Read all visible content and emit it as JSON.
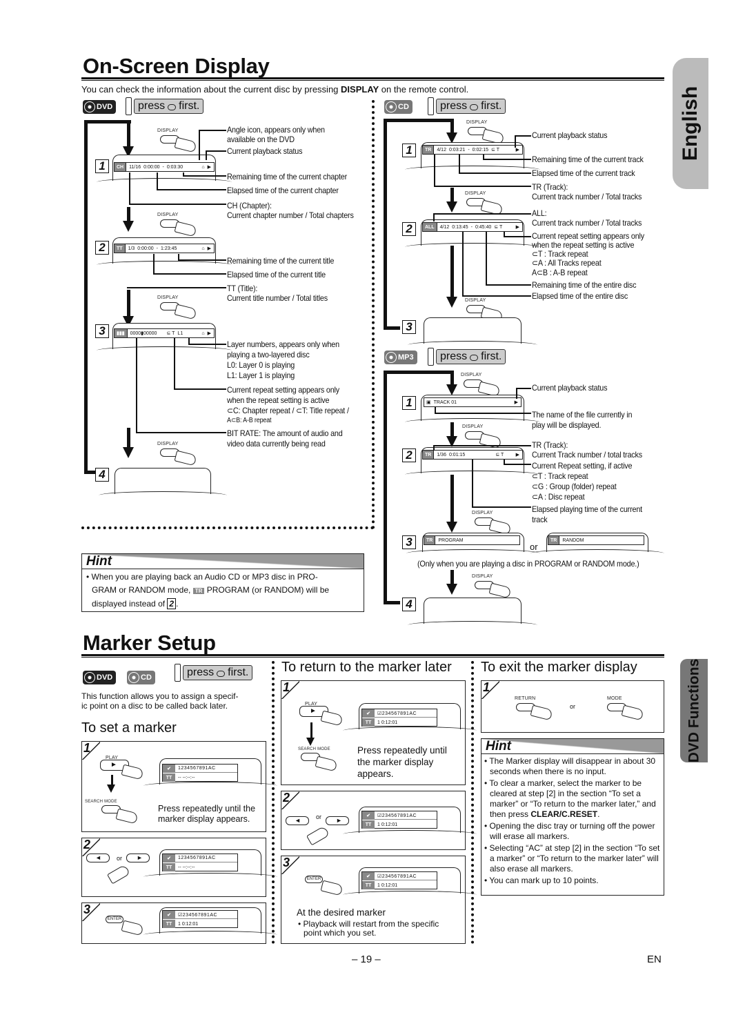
{
  "osd": {
    "title": "On-Screen Display",
    "intro_pre": "You can check the information about the current disc by pressing ",
    "intro_bold": "DISPLAY",
    "intro_post": " on the remote control.",
    "press_label": "press",
    "press_key": "DVD",
    "press_first": "first.",
    "display_btn": "DISPLAY",
    "dvd": {
      "badge": "DVD",
      "steps": [
        "1",
        "2",
        "3",
        "4"
      ],
      "step1": {
        "tag": "CH",
        "count": "11/16",
        "elapsed": "0:00:00",
        "remaining": "0:03:30",
        "status": "▶"
      },
      "step2": {
        "tag": "TT",
        "count": "1/3",
        "elapsed": "0:00:00",
        "remaining": "1:23:45",
        "status": "▶"
      },
      "step3": {
        "tag": "▮▮▮",
        "bitrate": "0000▮00000",
        "repeat": "⊆ T",
        "layer": "L1",
        "status": "▶"
      },
      "notes": [
        "Angle icon, appears only when",
        "available on the DVD",
        "Current playback status",
        "Remaining time of the current chapter",
        "Elapsed time of the current chapter",
        "CH (Chapter):",
        "Current chapter number / Total chapters",
        "Remaining time of the current title",
        "Elapsed time of the current title",
        "TT (Title):",
        "Current title number / Total titles",
        "Layer numbers, appears only when",
        "playing a two-layered disc",
        "L0: Layer 0 is playing",
        "L1: Layer 1 is playing",
        "Current repeat setting appears only",
        "when the repeat setting is active",
        "⊂C: Chapter repeat / ⊂T: Title repeat /",
        "A⊂B: A-B repeat",
        "BIT RATE: The amount of audio and",
        "video data currently being read"
      ]
    },
    "cd": {
      "badge": "CD",
      "steps": [
        "1",
        "2",
        "3"
      ],
      "step1": {
        "tag": "TR",
        "count": "4/12",
        "elapsed": "0:03:21",
        "remaining": "0:02:15",
        "repeat": "⊆ T",
        "status": "▶"
      },
      "step2": {
        "tag": "ALL",
        "count": "4/12",
        "elapsed": "0:13:45",
        "remaining": "0:45:40",
        "repeat": "⊆ T",
        "status": "▶"
      },
      "notes": [
        "Current playback status",
        "Remaining time of the current track",
        "Elapsed time of the current track",
        "TR (Track):",
        "Current track number / Total tracks",
        "ALL:",
        "Current track number / Total tracks",
        "Current repeat setting appears only",
        "when the repeat setting is active",
        "⊂T   : Track repeat",
        "⊂A   : All Tracks repeat",
        "A⊂B : A-B repeat",
        "Remaining time of the entire disc",
        "Elapsed time of the entire disc"
      ]
    },
    "mp3": {
      "badge": "MP3",
      "steps": [
        "1",
        "2",
        "3",
        "4"
      ],
      "step1": {
        "name": "TRACK 01",
        "status": "▶"
      },
      "step2": {
        "tag": "TR",
        "count": "1/36",
        "elapsed": "0:01:15",
        "repeat": "⊆ T",
        "status": "▶"
      },
      "step3": {
        "tag": "TR",
        "program": "PROGRAM",
        "or": "or",
        "random": "RANDOM"
      },
      "only_when": "(Only when you are playing a disc in PROGRAM or RANDOM mode.)",
      "notes": [
        "Current playback status",
        "The name of the file currently in",
        "play will be displayed.",
        "TR (Track):",
        "Current Track number / total tracks",
        "Current Repeat setting, if active",
        "⊂T : Track repeat",
        "⊂G : Group (folder) repeat",
        "⊂A : Disc repeat",
        "Elapsed playing time of the current",
        "track"
      ]
    },
    "hint": {
      "title": "Hint",
      "line1": "• When you are playing back an Audio CD or MP3 disc in PRO-",
      "line2_pre": "GRAM or RANDOM mode, ",
      "line2_tag": "TR",
      "line2_post": " PROGRAM (or RANDOM) will be",
      "line3_pre": "displayed instead of ",
      "line3_step": "2",
      "line3_post": "."
    }
  },
  "side_tabs": {
    "english": "English",
    "dvd_functions": "DVD Functions"
  },
  "marker": {
    "title": "Marker Setup",
    "badges": [
      "DVD",
      "CD"
    ],
    "intro1": "This function allows you to assign a specif-",
    "intro2": "ic point on a disc to be called back later.",
    "set": {
      "heading": "To set a marker",
      "steps": [
        "1",
        "2",
        "3"
      ],
      "play_btn": "PLAY",
      "search_btn": "SEARCH MODE",
      "enter_btn": "ENTER",
      "or": "or",
      "press_text1": "Press repeatedly until the",
      "press_text2": "marker display appears.",
      "cells_empty": "1234567891AC",
      "time_empty": "-- --:--:--",
      "cells_set": "☑234567891AC",
      "time_set": "1  0:12:01",
      "tt": "TT"
    },
    "return": {
      "heading": "To return to the marker later",
      "steps": [
        "1",
        "2",
        "3"
      ],
      "play_btn": "PLAY",
      "search_btn": "SEARCH MODE",
      "enter_btn": "ENTER",
      "or": "or",
      "press_text": [
        "Press repeatedly until",
        "the marker display",
        "appears."
      ],
      "cells": "☑234567891AC",
      "time": "1  0:12:01",
      "tt": "TT",
      "desired": "At the desired marker",
      "restart1": "• Playback will restart from the specific",
      "restart2": "point which you set."
    },
    "exit": {
      "heading": "To exit the marker display",
      "step": "1",
      "return_btn": "RETURN",
      "mode_btn": "MODE",
      "or": "or"
    },
    "hint": {
      "title": "Hint",
      "items": [
        "• The Marker display will disappear in about 30 seconds when there is no input.",
        "• To clear a marker, select the marker to be cleared at step [2] in the section “To set a marker” or “To return to the marker later,” and then press ",
        "• Opening the disc tray or turning off the power will erase all markers.",
        "• Selecting “AC” at step [2] in the section “To set a marker” or “To return to the marker later” will also erase all markers.",
        "• You can mark up to 10 points."
      ],
      "clear_bold": "CLEAR/C.RESET",
      "clear_end": "."
    }
  },
  "footer": {
    "page": "– 19 –",
    "lang": "EN"
  }
}
